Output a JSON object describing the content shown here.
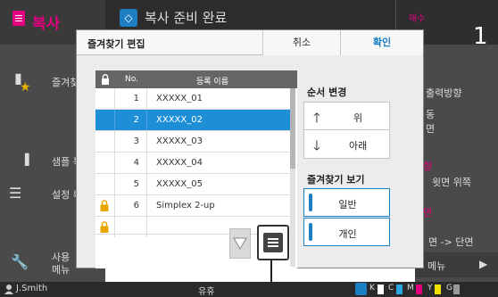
{
  "app": {
    "title": "복사",
    "status_text": "복사 준비 완료",
    "copies_label": "매수",
    "copies_value": "1"
  },
  "left_panel": {
    "items": [
      {
        "icon": "favorites-icon",
        "label": "즐겨찾"
      },
      {
        "icon": "sample-icon",
        "label": "샘플 복"
      },
      {
        "icon": "list-icon",
        "label": "설정 확"
      },
      {
        "icon": "wrench-icon",
        "label": "사용",
        "label2": "메뉴"
      }
    ]
  },
  "right_panel": {
    "orientation_head": "출력방향",
    "orientation_1": "동",
    "orientation_2": "면",
    "side_head": "향",
    "side_value": "윗면 위쪽",
    "duplex_head": "면",
    "duplex_value": "면 -> 단면",
    "menu_label": "메뉴"
  },
  "dialog": {
    "title": "즐겨찾기 편집",
    "cancel_label": "취소",
    "ok_label": "확인",
    "table": {
      "col_no": "No.",
      "col_name": "등록 이름",
      "rows": [
        {
          "no": "1",
          "name": "XXXXX_01",
          "locked": false,
          "selected": false
        },
        {
          "no": "2",
          "name": "XXXXX_02",
          "locked": false,
          "selected": true
        },
        {
          "no": "3",
          "name": "XXXXX_03",
          "locked": false,
          "selected": false
        },
        {
          "no": "4",
          "name": "XXXXX_04",
          "locked": false,
          "selected": false
        },
        {
          "no": "5",
          "name": "XXXXX_05",
          "locked": false,
          "selected": false
        },
        {
          "no": "6",
          "name": "Simplex 2-up",
          "locked": true,
          "selected": false
        }
      ]
    },
    "order_label": "순서 변경",
    "up_label": "위",
    "down_label": "아래",
    "view_label": "즐겨찾기 보기",
    "view_general": "일반",
    "view_personal": "개인"
  },
  "bottom_bar": {
    "user": "J.Smith",
    "status": "유휴",
    "ink": [
      "K",
      "C",
      "M",
      "Y",
      "G"
    ]
  },
  "colors": {
    "accent": "#1e8fd6",
    "brand": "#e3007f",
    "lock": "#e8a800"
  }
}
